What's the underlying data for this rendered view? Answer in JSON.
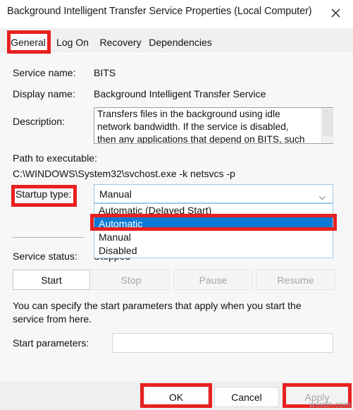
{
  "window": {
    "title": "Background Intelligent Transfer Service Properties (Local Computer)",
    "close_icon": "close-icon"
  },
  "tabs": [
    {
      "label": "General",
      "active": true
    },
    {
      "label": "Log On",
      "active": false
    },
    {
      "label": "Recovery",
      "active": false
    },
    {
      "label": "Dependencies",
      "active": false
    }
  ],
  "general": {
    "service_name_label": "Service name:",
    "service_name_value": "BITS",
    "display_name_label": "Display name:",
    "display_name_value": "Background Intelligent Transfer Service",
    "description_label": "Description:",
    "description_value": "Transfers files in the background using idle network bandwidth. If the service is disabled, then any applications that depend on BITS, such as Windows Update or MSN Explorer, will be unable to automatically download programs and other information.",
    "path_label": "Path to executable:",
    "path_value": "C:\\WINDOWS\\System32\\svchost.exe -k netsvcs -p",
    "startup_type_label": "Startup type:",
    "startup_type_value": "Manual",
    "startup_type_options": [
      "Automatic (Delayed Start)",
      "Automatic",
      "Manual",
      "Disabled"
    ],
    "startup_type_selected_index": 1,
    "service_status_label": "Service status:",
    "service_status_value": "Stopped",
    "service_buttons": [
      {
        "label": "Start",
        "enabled": true
      },
      {
        "label": "Stop",
        "enabled": false
      },
      {
        "label": "Pause",
        "enabled": false
      },
      {
        "label": "Resume",
        "enabled": false
      }
    ],
    "hint_text": "You can specify the start parameters that apply when you start the service from here.",
    "start_parameters_label": "Start parameters:",
    "start_parameters_value": "",
    "start_parameters_placeholder": ""
  },
  "footer": {
    "ok_label": "OK",
    "cancel_label": "Cancel",
    "apply_label": "Apply",
    "apply_enabled": false
  },
  "annotations": {
    "accent_color": "#e8201f",
    "highlight_color": "#0a7ad6",
    "targets": [
      "General tab",
      "Startup type label",
      "Automatic option",
      "OK button",
      "Apply button"
    ]
  },
  "watermark": {
    "text": "wsxdn.com"
  }
}
